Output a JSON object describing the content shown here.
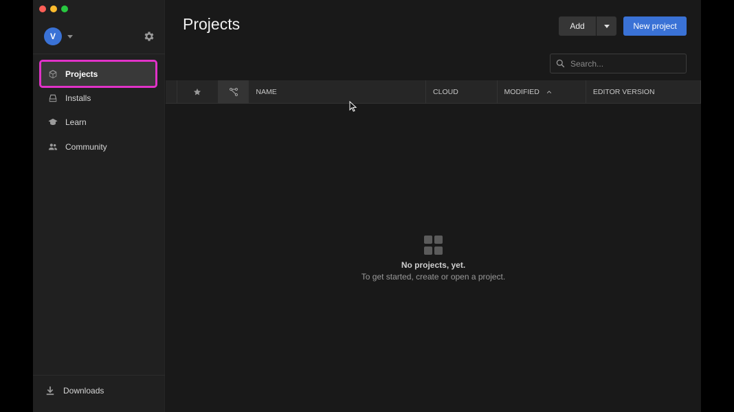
{
  "sidebar": {
    "avatar_initial": "V",
    "items": [
      {
        "label": "Projects",
        "icon": "cube-icon",
        "active": true
      },
      {
        "label": "Installs",
        "icon": "installs-icon",
        "active": false
      },
      {
        "label": "Learn",
        "icon": "graduation-cap-icon",
        "active": false
      },
      {
        "label": "Community",
        "icon": "people-icon",
        "active": false
      }
    ],
    "downloads_label": "Downloads"
  },
  "main": {
    "title": "Projects",
    "add_label": "Add",
    "new_project_label": "New project",
    "search_placeholder": "Search...",
    "columns": {
      "name": "NAME",
      "cloud": "CLOUD",
      "modified": "MODIFIED",
      "editor_version": "EDITOR VERSION"
    },
    "empty": {
      "title": "No projects, yet.",
      "subtitle": "To get started, create or open a project."
    }
  },
  "colors": {
    "accent": "#3a72d6",
    "highlight": "#e132c8",
    "background": "#191919",
    "sidebar": "#202020"
  }
}
